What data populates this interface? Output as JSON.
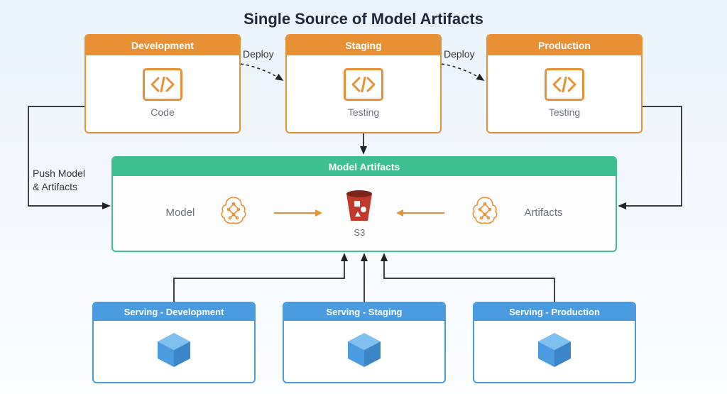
{
  "title": "Single Source of Model Artifacts",
  "environments": {
    "dev": {
      "header": "Development",
      "caption": "Code"
    },
    "stag": {
      "header": "Staging",
      "caption": "Testing"
    },
    "prod": {
      "header": "Production",
      "caption": "Testing"
    }
  },
  "deploy_labels": {
    "dev_stag": "Deploy",
    "stag_prod": "Deploy"
  },
  "push_label_line1": "Push Model",
  "push_label_line2": "& Artifacts",
  "artifacts": {
    "header": "Model Artifacts",
    "model_label": "Model",
    "artifacts_label": "Artifacts",
    "storage_label": "S3"
  },
  "serving": {
    "dev": "Serving - Development",
    "stag": "Serving - Staging",
    "prod": "Serving - Production"
  }
}
